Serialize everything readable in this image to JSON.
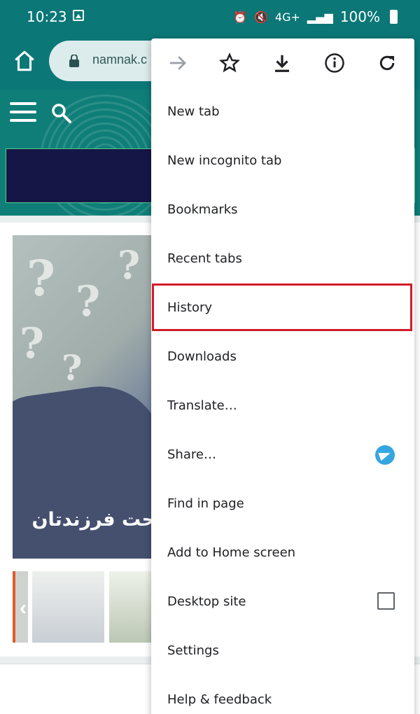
{
  "status_bar": {
    "time": "10:23",
    "network": "4G+",
    "battery": "100%"
  },
  "browser": {
    "url": "namnak.c"
  },
  "page": {
    "hero_caption": "حت فرزندتان"
  },
  "menu": {
    "top_icons": [
      "forward-icon",
      "bookmark-star-icon",
      "download-icon",
      "info-icon",
      "refresh-icon"
    ],
    "items": [
      {
        "label": "New tab"
      },
      {
        "label": "New incognito tab"
      },
      {
        "label": "Bookmarks"
      },
      {
        "label": "Recent tabs"
      },
      {
        "label": "History",
        "highlighted": true
      },
      {
        "label": "Downloads"
      },
      {
        "label": "Translate…"
      },
      {
        "label": "Share…",
        "trailing_icon": "telegram-icon"
      },
      {
        "label": "Find in page"
      },
      {
        "label": "Add to Home screen"
      },
      {
        "label": "Desktop site",
        "checkbox_checked": false
      },
      {
        "label": "Settings"
      },
      {
        "label": "Help & feedback"
      }
    ]
  },
  "colors": {
    "toolbar": "#0b7777",
    "highlight": "#d21b2b",
    "telegram": "#36a6e0"
  }
}
